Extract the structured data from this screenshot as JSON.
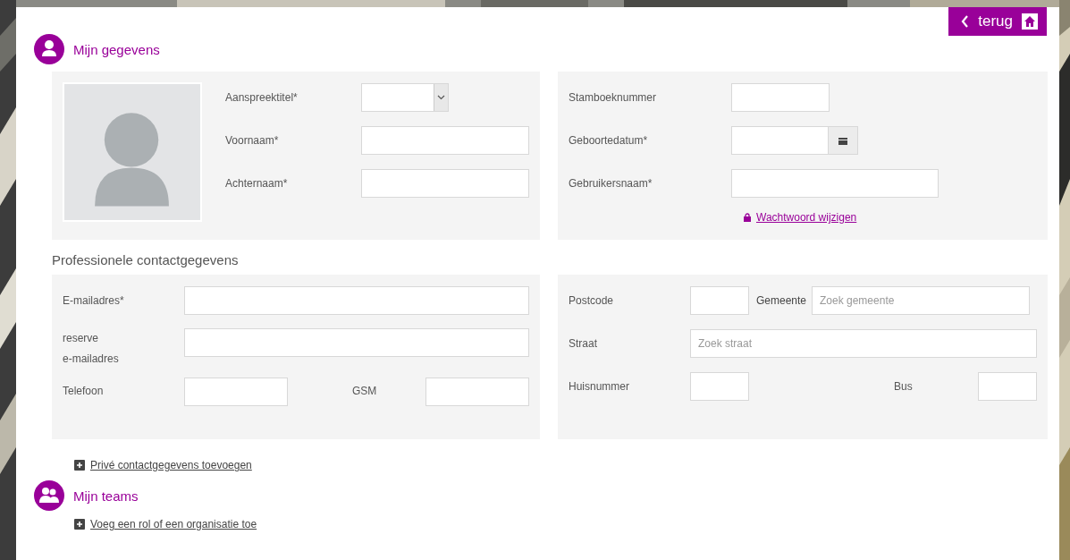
{
  "back_button": {
    "label": "terug"
  },
  "personal": {
    "title": "Mijn gegevens",
    "fields": [
      {
        "label": "Aanspreektitel*",
        "kind": "select"
      },
      {
        "label": "Voornaam*",
        "kind": "text"
      },
      {
        "label": "Achternaam*",
        "kind": "text"
      }
    ],
    "account_fields": [
      {
        "label": "Stamboeknummer",
        "kind": "short"
      },
      {
        "label": "Geboortedatum*",
        "kind": "date"
      },
      {
        "label": "Gebruikersnaam*",
        "kind": "text"
      }
    ],
    "password_link": "Wachtwoord wijzigen"
  },
  "professional": {
    "title": "Professionele contactgegevens",
    "email": {
      "label": "E-mailadres*"
    },
    "backup_email": {
      "label": "reserve\ne-mailadres"
    },
    "phone": {
      "label": "Telefoon"
    },
    "mobile": {
      "label": "GSM"
    },
    "postcode": {
      "label": "Postcode"
    },
    "municipality": {
      "label": "Gemeente",
      "placeholder": "Zoek gemeente"
    },
    "street": {
      "label": "Straat",
      "placeholder": "Zoek straat"
    },
    "house_number": {
      "label": "Huisnummer"
    },
    "box": {
      "label": "Bus"
    },
    "add_private_link": "Privé contactgegevens toevoegen"
  },
  "teams": {
    "title": "Mijn teams",
    "add_role_link": "Voeg een rol of een organisatie toe"
  }
}
